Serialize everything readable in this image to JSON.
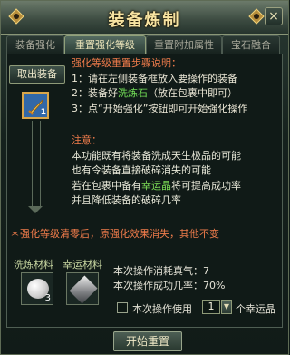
{
  "window": {
    "title": "装备炼制",
    "close_label": "×"
  },
  "tabs": [
    {
      "label": "装备强化",
      "active": false
    },
    {
      "label": "重置强化等级",
      "active": true
    },
    {
      "label": "重置附加属性",
      "active": false
    },
    {
      "label": "宝石融合",
      "active": false
    }
  ],
  "equipment": {
    "remove_label": "取出装备",
    "slot_level": "1"
  },
  "instructions": {
    "heading": "强化等级重置步骤说明：",
    "step1": "1：请在左侧装备框放入要操作的装备",
    "step2_prefix": "2：装备好",
    "step2_highlight": "洗炼石",
    "step2_suffix": "（放在包裹中即可）",
    "step3": "3：点“开始强化”按钮即可开始强化操作"
  },
  "notice": {
    "heading": "注意：",
    "line1": "本功能既有将装备洗成天生极品的可能",
    "line2": "也有令装备直接破碎消失的可能",
    "line3_prefix": "若在包裹中备有",
    "line3_highlight": "幸运晶",
    "line3_suffix": "将可提高成功率",
    "line4": "并且降低装备的破碎几率"
  },
  "warning": "＊强化等级清零后，原强化效果消失，其他不变",
  "materials": {
    "wash_label": "洗炼材料",
    "lucky_label": "幸运材料",
    "wash_count": "3",
    "wash_icon": "washing-stone-icon",
    "lucky_icon": "lucky-crystal-icon"
  },
  "stats": {
    "cost": "本次操作消耗真气：7",
    "success": "本次操作成功几率：70%"
  },
  "lucky_use": {
    "checked": false,
    "label": "本次操作使用",
    "qty": "1",
    "dropdown_arrow": "▼",
    "suffix": "个幸运晶"
  },
  "start_button": "开始重置",
  "colors": {
    "heading_orange": "#f07c4b",
    "highlight_green": "#73e057",
    "title_gold": "#f7e3a1"
  }
}
